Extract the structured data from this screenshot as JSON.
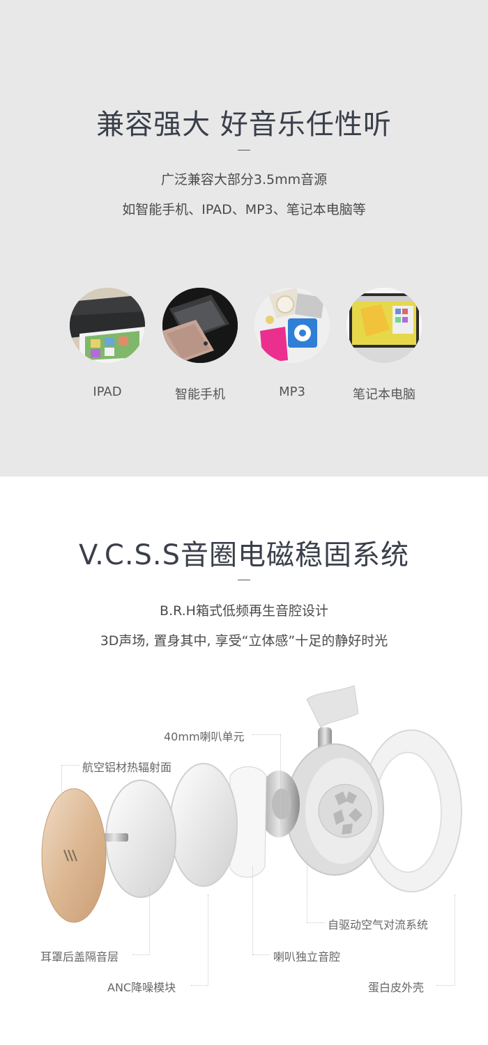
{
  "section1": {
    "title": "兼容强大 好音乐任性听",
    "line1": "广泛兼容大部分3.5mm音源",
    "line2": "如智能手机、IPAD、MP3、笔记本电脑等",
    "devices": [
      {
        "label": "IPAD",
        "icon": "tablet-image"
      },
      {
        "label": "智能手机",
        "icon": "smartphone-image"
      },
      {
        "label": "MP3",
        "icon": "mp3-player-image"
      },
      {
        "label": "笔记本电脑",
        "icon": "laptop-image"
      }
    ],
    "background": "#e8e8e8"
  },
  "section2": {
    "title": "V.C.S.S音圈电磁稳固系统",
    "line1": "B.R.H箱式低频再生音腔设计",
    "line2": "3D声场, 置身其中, 享受“立体感”十足的静好时光",
    "callouts": {
      "driver": "40mm喇叭单元",
      "heatsink": "航空铝材热辐射面",
      "convection": "自驱动空气对流系统",
      "isolation": "耳罩后盖隔音层",
      "chamber": "喇叭独立音腔",
      "anc": "ANC降噪模块",
      "shell": "蛋白皮外壳"
    },
    "accent_gold": "#d9b896"
  }
}
